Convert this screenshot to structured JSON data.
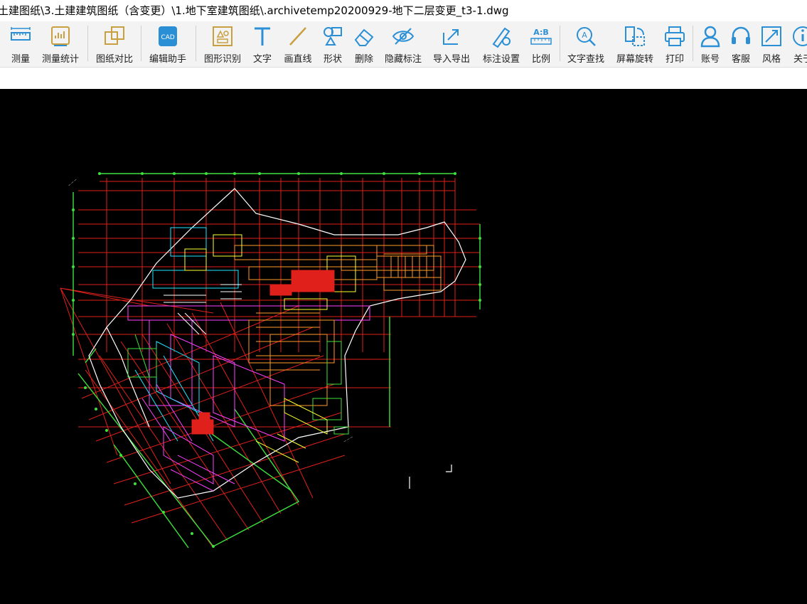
{
  "window": {
    "title": "土建图纸\\3.土建建筑图纸（含变更）\\1.地下室建筑图纸\\.archivetemp20200929-地下二层变更_t3-1.dwg"
  },
  "toolbar": {
    "items": [
      {
        "label": "测量",
        "icon": "ruler-icon"
      },
      {
        "label": "测量统计",
        "icon": "measure-stats-icon"
      },
      {
        "label": "图纸对比",
        "icon": "compare-icon"
      },
      {
        "label": "编辑助手",
        "icon": "cad-edit-icon"
      },
      {
        "label": "图形识别",
        "icon": "shape-recognize-icon"
      },
      {
        "label": "文字",
        "icon": "text-icon"
      },
      {
        "label": "画直线",
        "icon": "line-icon"
      },
      {
        "label": "形状",
        "icon": "shapes-icon"
      },
      {
        "label": "删除",
        "icon": "eraser-icon"
      },
      {
        "label": "隐藏标注",
        "icon": "hide-eye-icon"
      },
      {
        "label": "导入导出",
        "icon": "import-export-icon"
      },
      {
        "label": "标注设置",
        "icon": "annotation-settings-icon"
      },
      {
        "label": "比例",
        "icon": "scale-icon"
      },
      {
        "label": "文字查找",
        "icon": "text-search-icon"
      },
      {
        "label": "屏幕旋转",
        "icon": "rotate-screen-icon"
      },
      {
        "label": "打印",
        "icon": "print-icon"
      },
      {
        "label": "账号",
        "icon": "user-icon"
      },
      {
        "label": "客服",
        "icon": "headset-icon"
      },
      {
        "label": "风格",
        "icon": "style-icon"
      },
      {
        "label": "关于",
        "icon": "info-icon"
      }
    ]
  },
  "colors": {
    "accent": "#2b8fd6",
    "gold": "#c8a040",
    "drawing_bg": "#000000"
  }
}
